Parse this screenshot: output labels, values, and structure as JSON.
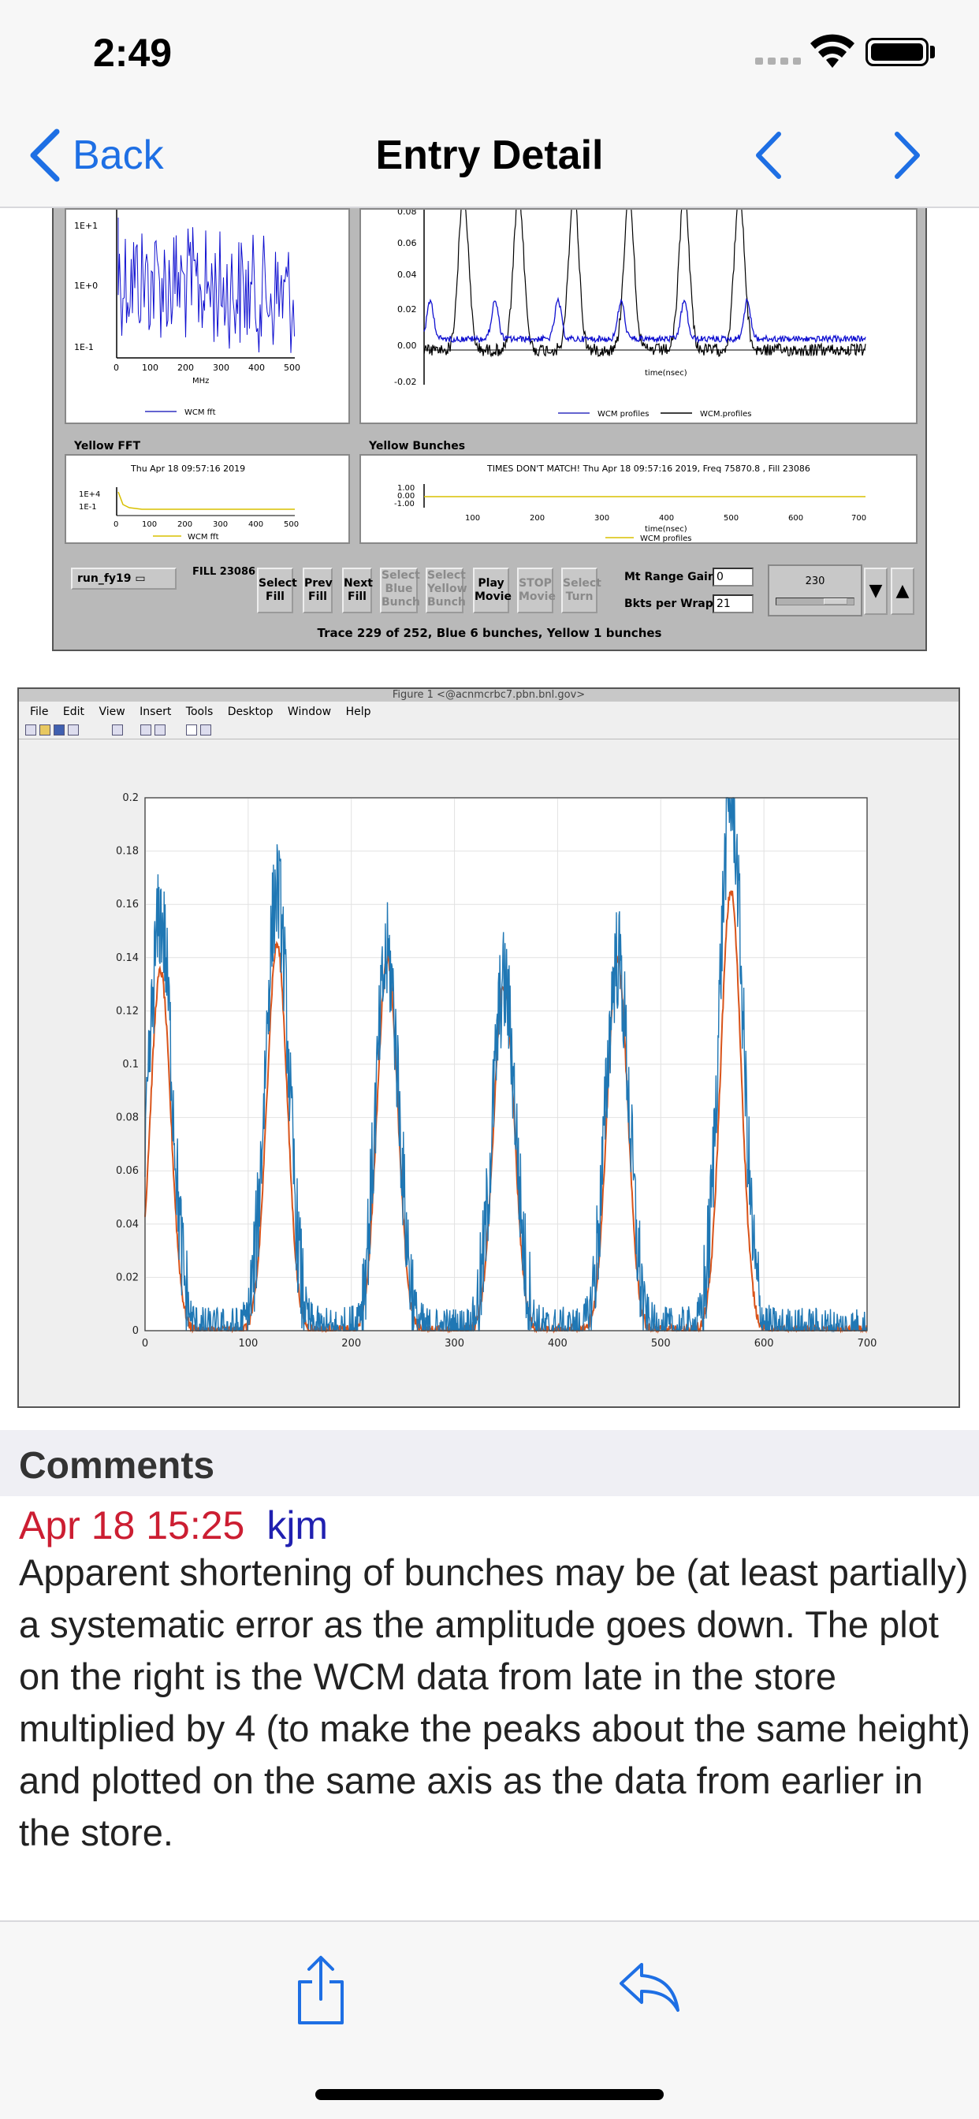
{
  "status_bar": {
    "time": "2:49"
  },
  "nav": {
    "back_label": "Back",
    "title": "Entry Detail",
    "accent": "#1e6fe4"
  },
  "screenshot1": {
    "group_yellow_fft": "Yellow FFT",
    "group_yellow_bunches": "Yellow Bunches",
    "blue_fft": {
      "yticks": [
        "1E+1",
        "1E+0",
        "1E-1"
      ],
      "xticks": [
        "0",
        "100",
        "200",
        "300",
        "400",
        "500"
      ],
      "xlabel": "MHz",
      "legend": "WCM fft"
    },
    "blue_bunches": {
      "yticks": [
        "0.08",
        "0.06",
        "0.04",
        "0.02",
        "0.00",
        "-0.02"
      ],
      "xlabel": "time(nsec)",
      "legend": [
        "WCM profiles",
        "WCM.profiles"
      ]
    },
    "yellow_fft": {
      "title": "Thu Apr 18 09:57:16 2019",
      "yticks": [
        "1E+4",
        "1E-1"
      ],
      "xticks": [
        "0",
        "100",
        "200",
        "300",
        "400",
        "500"
      ],
      "legend": "WCM fft"
    },
    "yellow_bunches": {
      "title": "TIMES DON'T MATCH!   Thu Apr 18 09:57:16 2019, Freq 75870.8 , Fill 23086",
      "yticks": [
        "1.00",
        "0.00",
        "-1.00"
      ],
      "xticks": [
        "100",
        "200",
        "300",
        "400",
        "500",
        "600",
        "700"
      ],
      "xlabel": "time(nsec)",
      "legend": "WCM profiles"
    },
    "run_select": "run_fy19",
    "fill_label": "FILL 23086",
    "buttons": [
      {
        "label": "Select Fill",
        "enabled": true
      },
      {
        "label": "Prev Fill",
        "enabled": true
      },
      {
        "label": "Next Fill",
        "enabled": true
      },
      {
        "label": "Select Blue Bunch",
        "enabled": false
      },
      {
        "label": "Select Yellow Bunch",
        "enabled": false
      },
      {
        "label": "Play Movie",
        "enabled": true
      },
      {
        "label": "STOP Movie",
        "enabled": false
      },
      {
        "label": "Select Turn",
        "enabled": false
      }
    ],
    "mt_range_gain_label": "Mt Range Gain",
    "mt_range_gain_value": "0",
    "bkts_per_wrap_label": "Bkts per Wrap",
    "bkts_per_wrap_value": "21",
    "slider_value": "230",
    "status": "Trace 229 of 252, Blue 6 bunches, Yellow 1 bunches"
  },
  "screenshot2": {
    "window_title": "Figure 1 <@acnmcrbc7.pbn.bnl.gov>",
    "menu": [
      "File",
      "Edit",
      "View",
      "Insert",
      "Tools",
      "Desktop",
      "Window",
      "Help"
    ],
    "colors": {
      "early": "#1f77b4",
      "late": "#d95319"
    },
    "chart_data": {
      "type": "line",
      "xlim": [
        0,
        700
      ],
      "ylim": [
        0,
        0.2
      ],
      "xticks": [
        0,
        100,
        200,
        300,
        400,
        500,
        600,
        700
      ],
      "yticks": [
        0,
        0.02,
        0.04,
        0.06,
        0.08,
        0.1,
        0.12,
        0.14,
        0.16,
        0.18,
        0.2
      ],
      "grid": true,
      "series": [
        {
          "peak_centers": [
            15,
            128,
            235,
            348,
            458,
            568
          ],
          "peak_heights": [
            0.155,
            0.165,
            0.14,
            0.13,
            0.14,
            0.2
          ]
        },
        {
          "peak_centers": [
            15,
            128,
            235,
            348,
            458,
            568
          ],
          "peak_heights": [
            0.135,
            0.145,
            0.14,
            0.13,
            0.14,
            0.165
          ]
        }
      ]
    }
  },
  "comments": {
    "header": "Comments",
    "date": "Apr 18 15:25",
    "author": "kjm",
    "body": "Apparent shortening of bunches may be (at least partially) a systematic error as the amplitude goes down. The plot on the right is the WCM data from late in the store multiplied by 4 (to make the peaks about the same height) and plotted on the same axis as the data from earlier in the store."
  }
}
